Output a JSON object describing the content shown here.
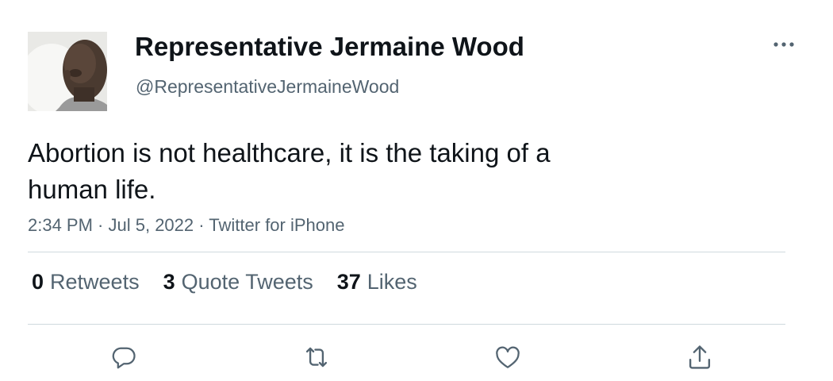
{
  "author": {
    "display_name": "Representative Jermaine Wood",
    "handle": "@RepresentativeJermaineWood"
  },
  "tweet": {
    "text_line1": "Abortion is not healthcare, it is the taking of a",
    "text_line2": "human life.",
    "time": "2:34 PM",
    "date": "Jul 5, 2022",
    "source": "Twitter for iPhone",
    "separator": " · "
  },
  "stats": {
    "retweets_count": "0",
    "retweets_label": "Retweets",
    "quotes_count": "3",
    "quotes_label": "Quote Tweets",
    "likes_count": "37",
    "likes_label": "Likes"
  },
  "actions": {
    "reply_icon": "reply-icon",
    "retweet_icon": "retweet-icon",
    "like_icon": "like-icon",
    "share_icon": "share-icon"
  },
  "colors": {
    "text": "#0f1419",
    "secondary": "#536471",
    "divider": "#cfd9de"
  }
}
